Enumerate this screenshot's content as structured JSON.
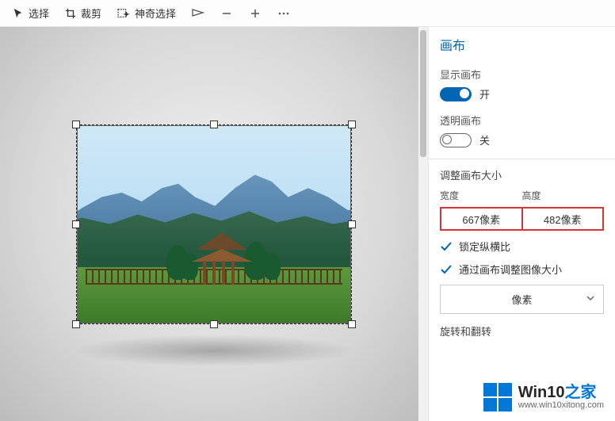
{
  "toolbar": {
    "select_label": "选择",
    "crop_label": "裁剪",
    "magic_select_label": "神奇选择"
  },
  "sidebar": {
    "title": "画布",
    "show_canvas": {
      "label": "显示画布",
      "state": "开",
      "on": true
    },
    "transparent_canvas": {
      "label": "透明画布",
      "state": "关",
      "on": false
    },
    "resize_heading": "调整画布大小",
    "width_label": "宽度",
    "height_label": "高度",
    "width_value": "667像素",
    "height_value": "482像素",
    "lock_aspect": "锁定纵横比",
    "resize_with_canvas": "通过画布调整图像大小",
    "unit": "像素",
    "rotate_heading": "旋转和翻转"
  },
  "watermark": {
    "brand_main": "Win10",
    "brand_suffix": "之家",
    "url": "www.win10xitong.com"
  }
}
